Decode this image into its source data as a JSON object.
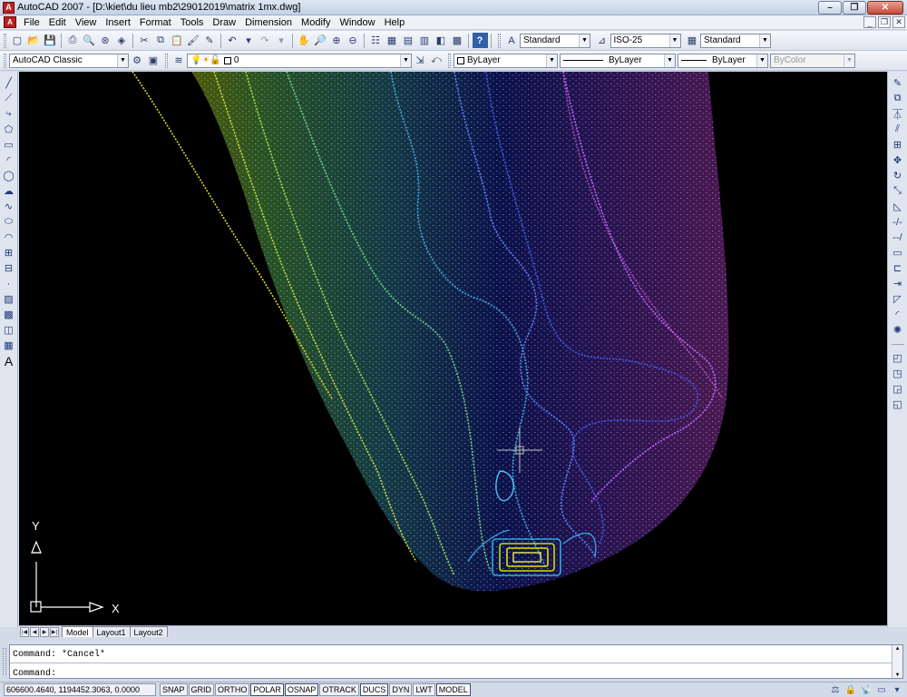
{
  "window": {
    "title": "AutoCAD 2007 - [D:\\kiet\\du lieu mb2\\29012019\\matrix 1mx.dwg]",
    "app_icon_label": "A"
  },
  "menu": {
    "items": [
      "File",
      "Edit",
      "View",
      "Insert",
      "Format",
      "Tools",
      "Draw",
      "Dimension",
      "Modify",
      "Window",
      "Help"
    ]
  },
  "toolbar_styles": {
    "text_style": "Standard",
    "dim_style": "ISO-25",
    "table_style": "Standard"
  },
  "toolbar_layers": {
    "workspace": "AutoCAD Classic",
    "layer": "0",
    "color": "ByLayer",
    "linetype": "ByLayer",
    "lineweight": "ByLayer",
    "plot_style": "ByColor"
  },
  "canvas": {
    "background": "#000000",
    "ucs_y_label": "Y",
    "ucs_x_label": "X"
  },
  "tabs": {
    "items": [
      "Model",
      "Layout1",
      "Layout2"
    ],
    "active": "Model"
  },
  "command_line": {
    "history": "Command: *Cancel*",
    "prompt": "Command:"
  },
  "status": {
    "coordinates": "606600.4640, 1194452.3063, 0.0000",
    "toggles": [
      {
        "label": "SNAP",
        "on": false
      },
      {
        "label": "GRID",
        "on": false
      },
      {
        "label": "ORTHO",
        "on": false
      },
      {
        "label": "POLAR",
        "on": true
      },
      {
        "label": "OSNAP",
        "on": true
      },
      {
        "label": "OTRACK",
        "on": false
      },
      {
        "label": "DUCS",
        "on": true
      },
      {
        "label": "DYN",
        "on": false
      },
      {
        "label": "LWT",
        "on": false
      },
      {
        "label": "MODEL",
        "on": true
      }
    ]
  }
}
